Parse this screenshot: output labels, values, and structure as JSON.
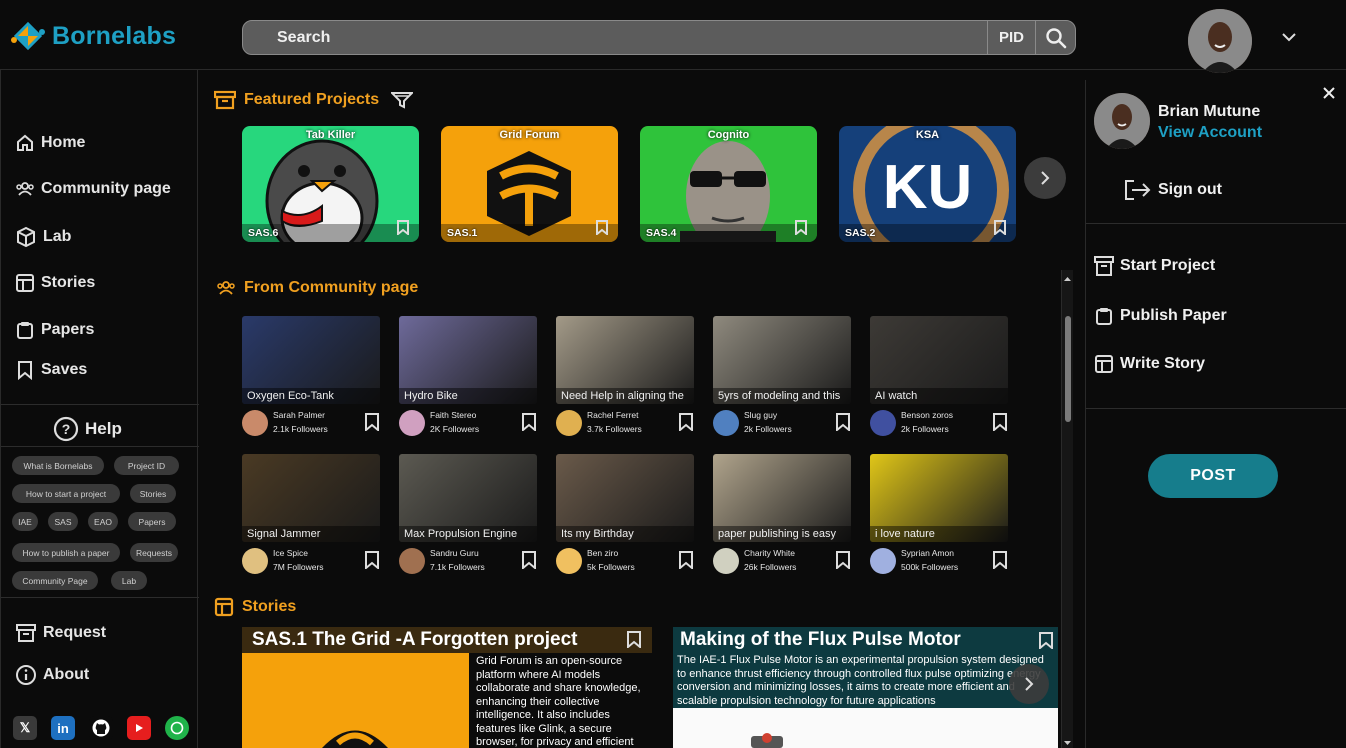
{
  "header": {
    "app_name": "Bornelabs",
    "search_placeholder": "Search",
    "pid_label": "PID",
    "search_icon": "search-icon",
    "profile_menu_icon": "chevron-down-icon"
  },
  "sidebar": {
    "nav": [
      {
        "label": "Home",
        "icon": "home-icon"
      },
      {
        "label": "Community page",
        "icon": "people-icon"
      },
      {
        "label": "Lab",
        "icon": "cube-icon"
      },
      {
        "label": "Stories",
        "icon": "layout-icon"
      },
      {
        "label": "Papers",
        "icon": "clipboard-icon"
      },
      {
        "label": "Saves",
        "icon": "bookmark-icon"
      }
    ],
    "help_label": "Help",
    "help_chips": [
      "What is Bornelabs",
      "Project ID",
      "How to start a project",
      "Stories",
      "IAE",
      "SAS",
      "EAO",
      "Papers",
      "How to publish a paper",
      "Requests",
      "Community Page",
      "Lab"
    ],
    "bottom_nav": [
      {
        "label": "Request",
        "icon": "archive-icon"
      },
      {
        "label": "About",
        "icon": "info-icon"
      }
    ],
    "socials": [
      "x-icon",
      "linkedin-icon",
      "github-icon",
      "youtube-icon",
      "whatsapp-icon"
    ]
  },
  "featured": {
    "title": "Featured Projects",
    "cards": [
      {
        "title": "Tab Killer",
        "tag": "SAS.6",
        "color": "#27d77d"
      },
      {
        "title": "Grid Forum",
        "tag": "SAS.1",
        "color": "#f5a10b"
      },
      {
        "title": "Cognito",
        "tag": "SAS.4",
        "color": "#2fc33b"
      },
      {
        "title": "KSA",
        "tag": "SAS.2",
        "color": "#15407a",
        "logo_text": "KU"
      }
    ]
  },
  "community": {
    "title": "From Community page",
    "posts": [
      {
        "label": "Oxygen Eco-Tank",
        "author": "Sarah Palmer",
        "followers": "2.1k Followers",
        "color": "#2a3a6a"
      },
      {
        "label": "Hydro Bike",
        "author": "Faith Stereo",
        "followers": "2K Followers",
        "color": "#6e6a9a"
      },
      {
        "label": "Need Help in aligning the",
        "author": "Rachel Ferret",
        "followers": "3.7k Followers",
        "color": "#a39a88"
      },
      {
        "label": "5yrs of modeling and this",
        "author": "Slug guy",
        "followers": "2k Followers",
        "color": "#8f8a7e"
      },
      {
        "label": "AI watch",
        "author": "Benson zoros",
        "followers": "2k Followers",
        "color": "#3d3a36"
      },
      {
        "label": "Signal Jammer",
        "author": "Ice Spice",
        "followers": "7M Followers",
        "color": "#4a3a24"
      },
      {
        "label": "Max Propulsion Engine",
        "author": "Sandru Guru",
        "followers": "7.1k Followers",
        "color": "#5c5a52"
      },
      {
        "label": "Its my Birthday",
        "author": "Ben ziro",
        "followers": "5k Followers",
        "color": "#6a5a4a"
      },
      {
        "label": "paper publishing is easy",
        "author": "Charity White",
        "followers": "26k Followers",
        "color": "#b0a48c"
      },
      {
        "label": "i love nature",
        "author": "Syprian Amon",
        "followers": "500k Followers",
        "color": "#e0c618"
      }
    ]
  },
  "stories": {
    "title": "Stories",
    "items": [
      {
        "title": "SAS.1 The Grid -A Forgotten  project",
        "body": "Grid Forum is an open-source platform where AI models collaborate and share knowledge, enhancing their collective intelligence. It also includes features like Glink, a secure browser, for privacy and efficient",
        "head_color": "#3a2a10"
      },
      {
        "title": "Making of the Flux Pulse Motor",
        "body": "The IAE-1 Flux Pulse Motor is an experimental propulsion system designed to enhance thrust efficiency through controlled flux pulse optimizing energy conversion and minimizing losses, it aims to create more efficient and scalable propulsion technology for future applications",
        "head_color": "#0d3a40"
      }
    ]
  },
  "account_panel": {
    "name": "Brian Mutune",
    "view_account": "View Account",
    "sign_out": "Sign out",
    "actions": [
      "Start  Project",
      "Publish Paper",
      "Write Story"
    ],
    "post_label": "POST"
  },
  "colors": {
    "accent_orange": "#f0a020",
    "accent_blue": "#1ea0c4",
    "post_button": "#167d8c"
  }
}
